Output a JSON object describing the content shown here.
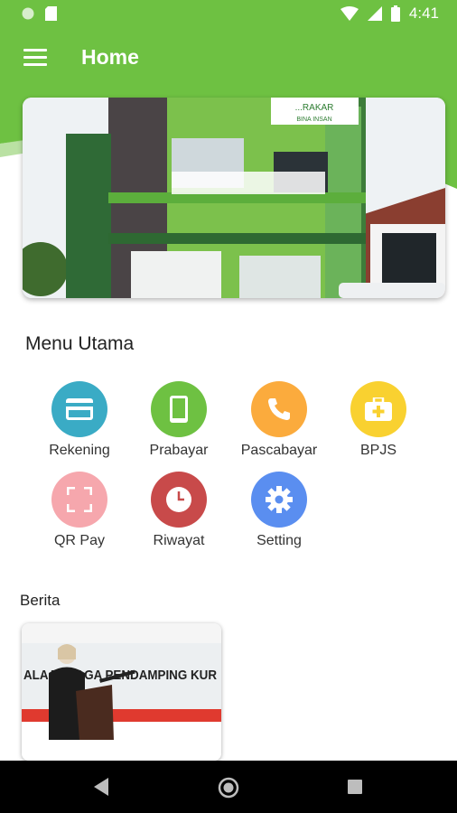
{
  "status_bar": {
    "time": "4:41"
  },
  "app_bar": {
    "title": "Home"
  },
  "main_menu": {
    "title": "Menu Utama",
    "items": [
      {
        "label": "Rekening",
        "icon": "credit-card-icon",
        "color": "#3aabc5"
      },
      {
        "label": "Prabayar",
        "icon": "phone-device-icon",
        "color": "#6ec142"
      },
      {
        "label": "Pascabayar",
        "icon": "phone-call-icon",
        "color": "#fbab3d"
      },
      {
        "label": "BPJS",
        "icon": "medical-kit-icon",
        "color": "#f9d130"
      },
      {
        "label": "QR Pay",
        "icon": "qr-scan-icon",
        "color": "#f6a7ad"
      },
      {
        "label": "Riwayat",
        "icon": "clock-icon",
        "color": "#c84a4a"
      },
      {
        "label": "Setting",
        "icon": "gear-icon",
        "color": "#5a8ef0"
      }
    ]
  },
  "news": {
    "title": "Berita",
    "items": [
      {
        "image_caption": "ALA TENAGA PENDAMPING KUR"
      }
    ]
  },
  "hero": {
    "sign_text_top": "...RAKAR",
    "sign_text_bottom": "BINA INSAN"
  },
  "colors": {
    "primary": "#6ec142"
  }
}
